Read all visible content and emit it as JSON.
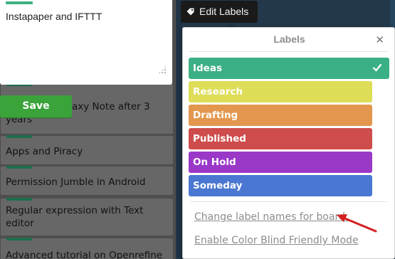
{
  "editor": {
    "card_text": "Instapaper and IFTTT",
    "save_label": "Save"
  },
  "list": {
    "cards": [
      {
        "title": "Galaxy Note after 3 years",
        "visible_text": "axy Note after 3\nyears"
      },
      {
        "title": "Apps and Piracy"
      },
      {
        "title": "Permission Jumble in Android"
      },
      {
        "title": "Regular expression with Text editor"
      },
      {
        "title": "Advanced tutorial on Openrefine"
      }
    ]
  },
  "edit_labels": {
    "label": "Edit Labels",
    "icon": "tag-icon"
  },
  "labels_popover": {
    "title": "Labels",
    "close_icon": "close-icon",
    "labels": [
      {
        "name": "Ideas",
        "color": "#3cb085",
        "selected": true
      },
      {
        "name": "Research",
        "color": "#dedd57",
        "selected": false
      },
      {
        "name": "Drafting",
        "color": "#e3974e",
        "selected": false
      },
      {
        "name": "Published",
        "color": "#cf4c4c",
        "selected": false
      },
      {
        "name": "On Hold",
        "color": "#9a38c8",
        "selected": false
      },
      {
        "name": "Someday",
        "color": "#4a77d1",
        "selected": false
      }
    ],
    "rename_link": "Change label names for board.",
    "colorblind_link": "Enable Color Blind Friendly Mode"
  },
  "annotation": {
    "arrow_color": "#d42020"
  }
}
